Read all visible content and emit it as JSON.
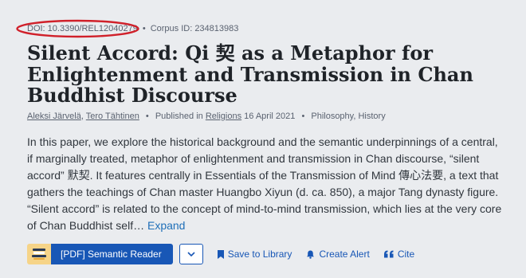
{
  "meta": {
    "doi": "DOI: 10.3390/REL12040279",
    "separator": "•",
    "corpus_id": "Corpus ID: 234813983"
  },
  "title": "Silent Accord: Qi 契 as a Metaphor for Enlightenment and Transmission in Chan Buddhist Discourse",
  "byline": {
    "authors": [
      "Aleksi Järvelä",
      "Tero Tähtinen"
    ],
    "author_sep": ", ",
    "separator": "•",
    "published_prefix": "Published in ",
    "venue": "Religions",
    "date": " 16 April 2021",
    "fields": "Philosophy, History"
  },
  "abstract": {
    "text": "In this paper, we explore the historical background and the semantic underpinnings of a central, if marginally treated, metaphor of enlightenment and transmission in Chan discourse, “silent accord” 默契. It features centrally in Essentials of the Transmission of Mind 傳心法要, a text that gathers the teachings of Chan master Huangbo Xiyun (d. ca. 850), a major Tang dynasty figure. “Silent accord” is related to the concept of mind-to-mind transmission, which lies at the very core of Chan Buddhist self…",
    "expand_label": "Expand"
  },
  "actions": {
    "reader_label": "[PDF] Semantic Reader",
    "save_label": "Save to Library",
    "alert_label": "Create Alert",
    "cite_label": "Cite"
  },
  "icons": {
    "reader": "book-stack-icon",
    "dropdown": "chevron-down-icon",
    "save": "bookmark-icon",
    "alert": "bell-icon",
    "cite": "quote-icon"
  },
  "colors": {
    "background": "#eaecef",
    "link": "#1857b6",
    "annotation": "#d0202a",
    "reader_icon_bg": "#f6d488"
  }
}
